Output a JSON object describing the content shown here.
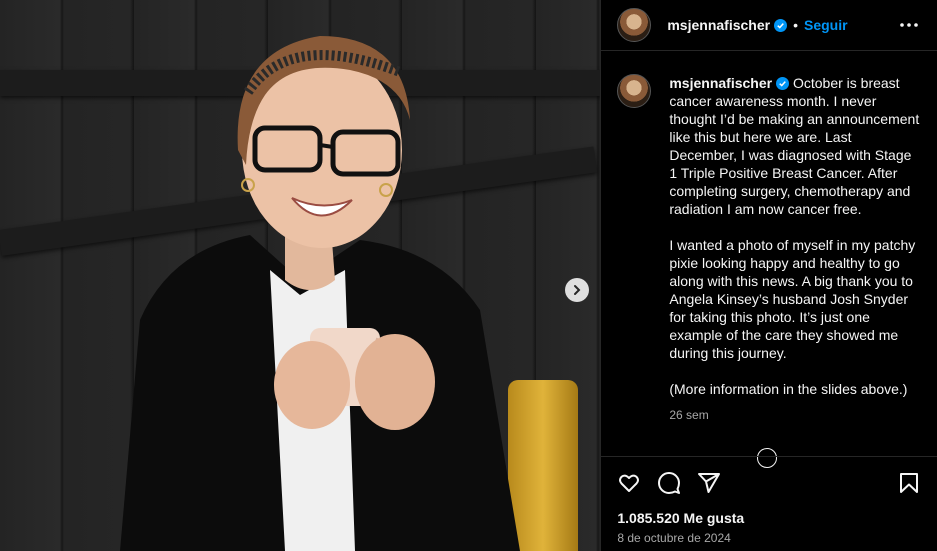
{
  "post": {
    "username": "msjennafischer",
    "follow_label": "Seguir",
    "separator": "•",
    "caption_p1": "October is breast cancer awareness month. I never thought I’d be making an announcement like this but here we are. Last December, I was diagnosed with Stage 1 Triple Positive Breast Cancer. After completing surgery, chemotherapy and radiation I am now cancer free.",
    "caption_p2": "I wanted a photo of myself in my patchy pixie looking happy and healthy to go along with this news. A big thank you to Angela Kinsey’s husband Josh Snyder for taking this photo. It’s just one example of the care they showed me during this journey.",
    "caption_p3": "(More information in the slides above.)",
    "time_ago": "26 sem",
    "likes": "1.085.520 Me gusta",
    "date": "8 de octubre de 2024"
  },
  "colors": {
    "background": "#000000",
    "accent": "#0095f6",
    "muted": "#a8a8a8",
    "verified": "#0095f6"
  },
  "icons": [
    "verified-badge-icon",
    "more-options-icon",
    "chevron-right-icon",
    "heart-icon",
    "comment-icon",
    "share-icon",
    "bookmark-icon"
  ]
}
